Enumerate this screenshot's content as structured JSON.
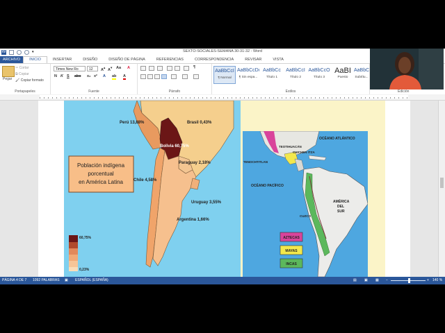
{
  "window": {
    "title": "SEXTO-SOCIALES-SEMANA 30-31-32 - Word"
  },
  "tabs": [
    "ARCHIVO",
    "INICIO",
    "INSERTAR",
    "DISEÑO",
    "DISEÑO DE PÁGINA",
    "REFERENCIAS",
    "CORRESPONDENCIA",
    "REVISAR",
    "VISTA"
  ],
  "ribbon": {
    "clipboard": {
      "paste": "Pegar",
      "cut": "Cortar",
      "copy": "Copiar",
      "format_painter": "Copiar formato",
      "label": "Portapapeles"
    },
    "font": {
      "name": "Times New Ro",
      "size": "12",
      "label": "Fuente",
      "bold": "N",
      "italic": "K",
      "underline": "S"
    },
    "paragraph": {
      "label": "Párrafo"
    },
    "styles": {
      "label": "Estilos",
      "items": [
        {
          "sample": "AaBbCcI",
          "name": "¶ Normal"
        },
        {
          "sample": "AaBbCcDc",
          "name": "¶ Sin espa..."
        },
        {
          "sample": "AaBbCc",
          "name": "Título 1"
        },
        {
          "sample": "AaBbCcI",
          "name": "Título 2"
        },
        {
          "sample": "AaBbCcO",
          "name": "Título 3"
        },
        {
          "sample": "AaBI",
          "name": "Puesto"
        },
        {
          "sample": "AaBbCc",
          "name": "Subtítu..."
        }
      ]
    },
    "editing": {
      "label": "Edición"
    }
  },
  "document": {
    "map1": {
      "title_lines": [
        "Población indígena",
        "porcentual",
        "en América Latina"
      ],
      "countries": [
        {
          "name": "Perú 13,88%"
        },
        {
          "name": "Brasil 0,43%"
        },
        {
          "name": "Bolivia 60,75%"
        },
        {
          "name": "Paraguay 2,18%"
        },
        {
          "name": "Chile 4,58%"
        },
        {
          "name": "Uruguay 3,55%"
        },
        {
          "name": "Argentina 1,66%"
        }
      ],
      "legend": {
        "max": "60,75%",
        "min": "0,23%"
      }
    },
    "map2": {
      "labels": {
        "atlantic": "OCÉANO ATLÁNTICO",
        "pacific": "OCÉANO PACÍFICO",
        "teotihuacan": "TEOTIHUACÁN",
        "chichen": "CHICHEN ITZA",
        "tenochtitlan": "TENOCHTITLAN",
        "cuzco": "CUZCO",
        "america_sur": [
          "AMÉRICA",
          "DEL",
          "SUR"
        ]
      },
      "legend": [
        {
          "name": "AZTECAS",
          "color": "#d9449b"
        },
        {
          "name": "MAYAS",
          "color": "#f2e84c"
        },
        {
          "name": "INCAS",
          "color": "#5cb85c"
        }
      ]
    }
  },
  "status": {
    "page": "PÁGINA 4 DE 7",
    "words": "1092 PALABRAS",
    "language": "ESPAÑOL (ESPAÑA)",
    "zoom": "140 %"
  },
  "colors": {
    "accent": "#2b579a"
  }
}
